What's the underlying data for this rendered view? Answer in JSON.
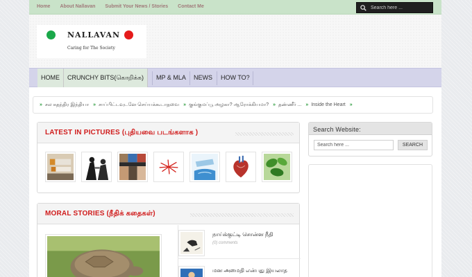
{
  "topnav": [
    "Home",
    "About Nallavan",
    "Submit Your News / Stories",
    "Contact Me"
  ],
  "top_search": {
    "placeholder": "Search here ..."
  },
  "logo": {
    "title": "NALLAVAN",
    "subtitle": "Caring for The Society"
  },
  "mainnav": [
    "HOME",
    "CRUNCHY BITS(கொறிக்க)",
    "MP & MLA",
    "NEWS",
    "HOW TO?"
  ],
  "ticker": {
    "items": [
      "சல சுதந்திர இந்தியா",
      "சாப்பிட்டவுடனே செய்யக்கூடாதவை",
      "குங்குமப்பூ அழகா? ஆரோக்கியமா?",
      "தண்ணீர் ...",
      "Inside the Heart"
    ]
  },
  "latest": {
    "title": "LATEST IN PICTURES (புதியவை படங்களாக )"
  },
  "moral": {
    "title": "MORAL STORIES (நீதிக் கதைகள்)"
  },
  "stories": [
    {
      "title": "நாய்க்குட்டி சொன்ன நீதி",
      "meta": "(0) comments"
    },
    {
      "title": "மன அமைதி என்பது இயலாத",
      "meta": ""
    }
  ],
  "side_search": {
    "title": "Search Website:",
    "placeholder": "Search here ...",
    "button": "SEARCH"
  },
  "colors": {
    "accent_red": "#d01c1c",
    "topbar_green": "#c9e3c9",
    "nav_lavender": "#d4d4ea",
    "ticker_arrow": "#2e9c3f"
  }
}
